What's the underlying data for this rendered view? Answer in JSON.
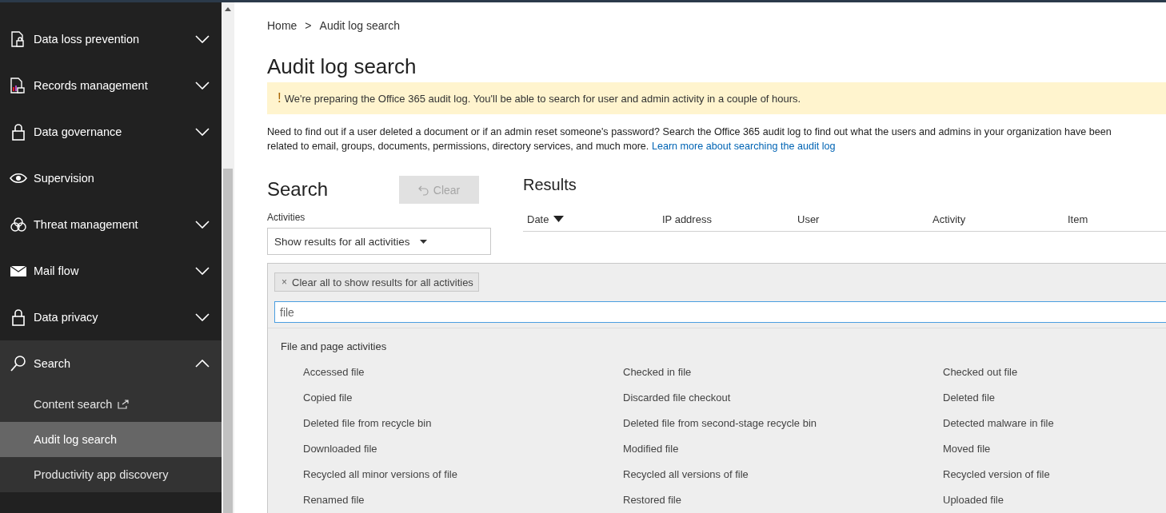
{
  "sidebar": {
    "items": [
      {
        "label": "Data loss prevention",
        "expanded": false
      },
      {
        "label": "Records management",
        "expanded": false
      },
      {
        "label": "Data governance",
        "expanded": false
      },
      {
        "label": "Supervision"
      },
      {
        "label": "Threat management",
        "expanded": false
      },
      {
        "label": "Mail flow",
        "expanded": false
      },
      {
        "label": "Data privacy",
        "expanded": false
      },
      {
        "label": "Search",
        "expanded": true,
        "children": [
          {
            "label": "Content search",
            "external": true,
            "selected": false
          },
          {
            "label": "Audit log search",
            "external": false,
            "selected": true
          },
          {
            "label": "Productivity app discovery",
            "external": false,
            "selected": false
          }
        ]
      }
    ]
  },
  "breadcrumb": [
    "Home",
    ">",
    "Audit log search"
  ],
  "page_title": "Audit log search",
  "banner": {
    "icon": "!",
    "text": "We're preparing the Office 365 audit log. You'll be able to search for user and admin activity in a couple of hours."
  },
  "description": {
    "lines": [
      "Need to find out if a user deleted a document or if an admin reset someone's password? Search the Office 365 audit log to find out what the users and admins in your organization have been",
      "related to email, groups, documents, permissions, directory services, and much more."
    ],
    "link": "Learn more about searching the audit log"
  },
  "search": {
    "title": "Search",
    "clear_button": {
      "label": "Clear",
      "disabled": true
    },
    "activities_label": "Activities",
    "activities_dropdown": "Show results for all activities"
  },
  "results": {
    "title": "Results",
    "columns": [
      {
        "label": "Date",
        "sorted": true
      },
      {
        "label": "IP address",
        "sorted": false
      },
      {
        "label": "User",
        "sorted": false
      },
      {
        "label": "Activity",
        "sorted": false
      },
      {
        "label": "Item",
        "sorted": false
      }
    ]
  },
  "activities_panel": {
    "clear_chip": {
      "icon": "×",
      "label": "Clear all to show results for all activities"
    },
    "filter_value": "file",
    "group": "File and page activities",
    "options": [
      "Accessed file",
      "Checked in file",
      "Checked out file",
      "Copied file",
      "Discarded file checkout",
      "Deleted file",
      "Deleted file from recycle bin",
      "Deleted file from second-stage recycle bin",
      "Detected malware in file",
      "Downloaded file",
      "Modified file",
      "Moved file",
      "Recycled all minor versions of file",
      "Recycled all versions of file",
      "Recycled version of file",
      "Renamed file",
      "Restored file",
      "Uploaded file"
    ]
  }
}
